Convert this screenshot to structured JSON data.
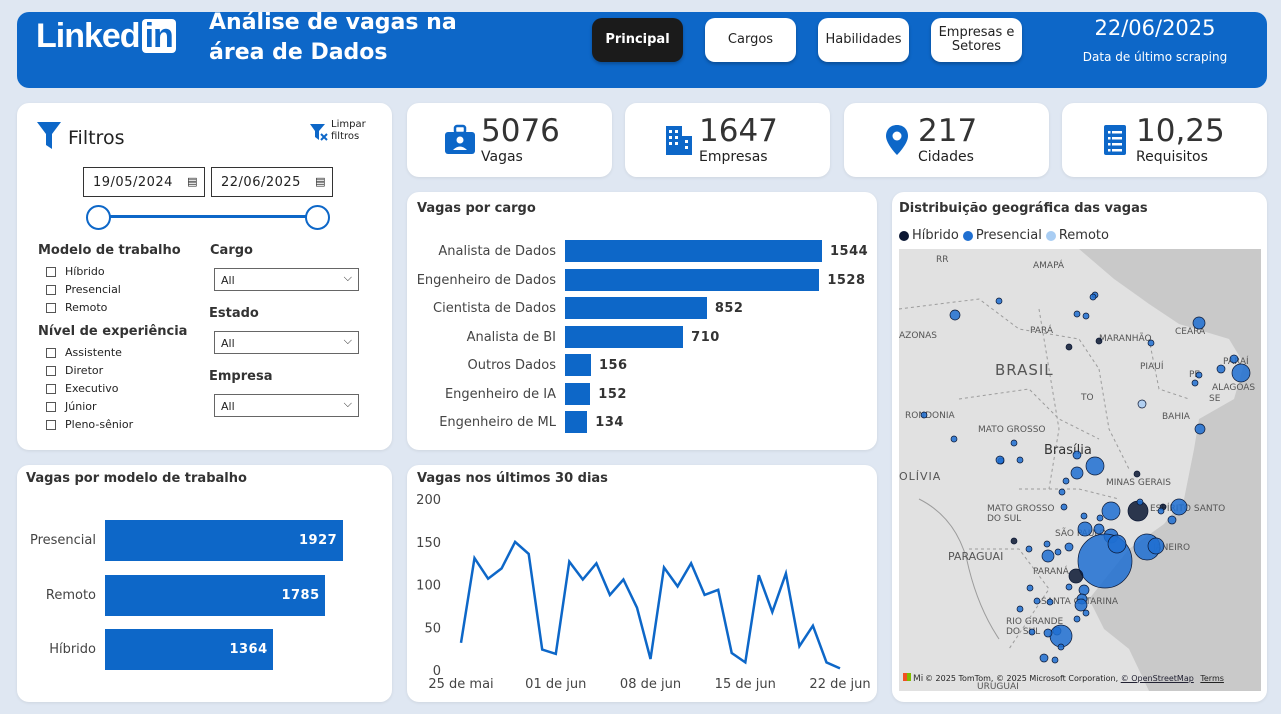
{
  "header": {
    "logo_text": "Linked",
    "logo_in": "in",
    "title_line1": "Análise de vagas na",
    "title_line2": "área de Dados",
    "nav": [
      "Principal",
      "Cargos",
      "Habilidades",
      "Empresas e Setores"
    ],
    "date": "22/06/2025",
    "date_caption": "Data de último scraping"
  },
  "kpis": [
    {
      "value": "5076",
      "label": "Vagas",
      "icon": "briefcase-icon"
    },
    {
      "value": "1647",
      "label": "Empresas",
      "icon": "building-icon"
    },
    {
      "value": "217",
      "label": "Cidades",
      "icon": "location-pin-icon"
    },
    {
      "value": "10,25",
      "label": "Requisitos",
      "icon": "list-document-icon"
    }
  ],
  "filters": {
    "title": "Filtros",
    "clear_label_1": "Limpar",
    "clear_label_2": "filtros",
    "date_start": "19/05/2024",
    "date_end": "22/06/2025",
    "modelo_label": "Modelo de trabalho",
    "modelo_options": [
      "Híbrido",
      "Presencial",
      "Remoto"
    ],
    "nivel_label": "Nível de experiência",
    "nivel_options": [
      "Assistente",
      "Diretor",
      "Executivo",
      "Júnior",
      "Pleno-sênior"
    ],
    "cargo_label": "Cargo",
    "cargo_value": "All",
    "estado_label": "Estado",
    "estado_value": "All",
    "empresa_label": "Empresa",
    "empresa_value": "All"
  },
  "vagas_por_cargo": {
    "title": "Vagas por cargo",
    "chart_data": {
      "type": "bar",
      "orientation": "horizontal",
      "categories": [
        "Analista de Dados",
        "Engenheiro de Dados",
        "Cientista de Dados",
        "Analista de BI",
        "Outros Dados",
        "Engenheiro de IA",
        "Engenheiro de ML"
      ],
      "values": [
        1544,
        1528,
        852,
        710,
        156,
        152,
        134
      ],
      "color": "#0d67c8"
    }
  },
  "vagas_por_modelo": {
    "title": "Vagas por modelo de trabalho",
    "chart_data": {
      "type": "bar",
      "orientation": "horizontal",
      "categories": [
        "Presencial",
        "Remoto",
        "Híbrido"
      ],
      "values": [
        1927,
        1785,
        1364
      ],
      "color": "#0d67c8"
    }
  },
  "vagas_30_dias": {
    "title": "Vagas nos últimos 30 dias",
    "chart_data": {
      "type": "line",
      "x": [
        "2025-05-25",
        "2025-05-26",
        "2025-05-27",
        "2025-05-28",
        "2025-05-29",
        "2025-05-30",
        "2025-05-31",
        "2025-06-01",
        "2025-06-02",
        "2025-06-03",
        "2025-06-04",
        "2025-06-05",
        "2025-06-06",
        "2025-06-07",
        "2025-06-08",
        "2025-06-09",
        "2025-06-10",
        "2025-06-11",
        "2025-06-12",
        "2025-06-13",
        "2025-06-14",
        "2025-06-15",
        "2025-06-16",
        "2025-06-17",
        "2025-06-18",
        "2025-06-19",
        "2025-06-20",
        "2025-06-21",
        "2025-06-22"
      ],
      "values": [
        33,
        132,
        108,
        120,
        151,
        137,
        25,
        20,
        128,
        107,
        126,
        89,
        107,
        74,
        14,
        121,
        99,
        126,
        89,
        95,
        21,
        10,
        112,
        69,
        114,
        29,
        53,
        10,
        3
      ],
      "ylim": [
        0,
        200
      ],
      "yticks": [
        0,
        50,
        100,
        150,
        200
      ],
      "xtick_labels": [
        "25 de mai",
        "01 de jun",
        "08 de jun",
        "15 de jun",
        "22 de jun"
      ],
      "color": "#0d67c8"
    }
  },
  "mapa": {
    "title": "Distribuição geográfica das vagas",
    "legend": [
      {
        "label": "Híbrido",
        "color": "#0b1733"
      },
      {
        "label": "Presencial",
        "color": "#1f6fd1"
      },
      {
        "label": "Remoto",
        "color": "#a9cdf3"
      }
    ],
    "labels": [
      "RR",
      "AMAPÁ",
      "PARÁ",
      "MARANHÃO",
      "CEARÁ",
      "PARAÍ",
      "PIAUÍ",
      "PE",
      "ALAGOAS",
      "SE",
      "BRASIL",
      "AZONAS",
      "TO",
      "BAHIA",
      "RONDONIA",
      "MATO GROSSO",
      "Brasília",
      "MINAS GERAIS",
      "OLÍVIA",
      "MATO GROSSO DO SUL",
      "SÃO PAULO",
      "PARAGUAI",
      "PARANÁ",
      "SANTA CATARINA",
      "RIO GRANDE DO SUL",
      "URUGUAI",
      "ESPÍRITO SANTO",
      "JANEIRO"
    ],
    "attribution": "© 2025 TomTom, © 2025 Microsoft Corporation,",
    "osm": "© OpenStreetMap",
    "terms": "Terms",
    "ms_logo": "Mi"
  }
}
